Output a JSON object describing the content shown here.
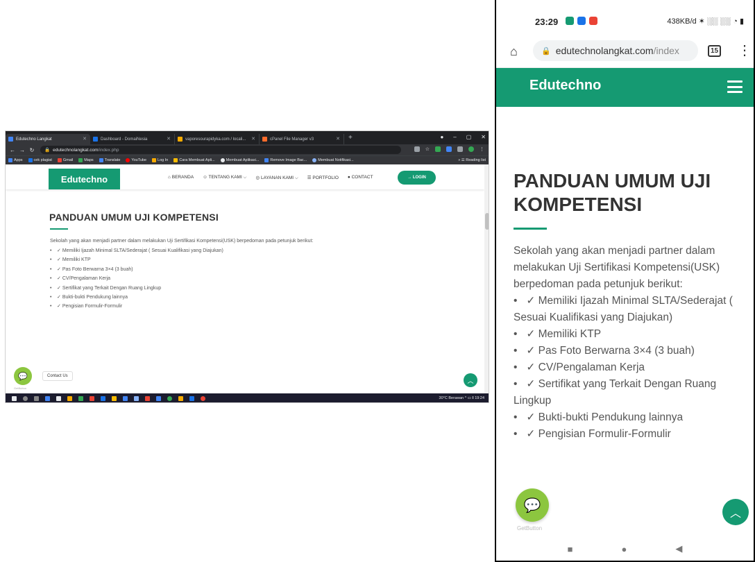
{
  "desktop": {
    "tabs": [
      {
        "title": "Edutechno Langkat",
        "color": "#4285f4",
        "active": true
      },
      {
        "title": "Dashboard - DomaiNesia",
        "color": "#1a73e8",
        "active": false
      },
      {
        "title": "vaporesourapidyka.com / locali...",
        "color": "#f9ab00",
        "active": false
      },
      {
        "title": "cPanel File Manager v3",
        "color": "#ff6c2c",
        "active": false
      }
    ],
    "url_host": "edutechnolangkat.com",
    "url_path": "/index.php",
    "bookmarks": [
      "Apps",
      "cek plagiat",
      "Gmail",
      "Maps",
      "Translate",
      "YouTube",
      "Log In",
      "Cara Membuat Apli...",
      "Membuat Aplikasi...",
      "Remove Image Bac...",
      "Membuat Notifikasi..."
    ],
    "reading_list": "Reading list",
    "brand": "Edutechno",
    "menu": [
      "⌂ BERANDA",
      "☺ TENTANG KAMI ⌵",
      "◎ LAYANAN KAMI ⌵",
      "☰ PORTFOLIO",
      "● CONTACT"
    ],
    "login": "→ LOGIN",
    "title": "PANDUAN UMUM UJI KOMPETENSI",
    "intro": "Sekolah yang akan menjadi partner dalam melakukan Uji Sertifikasi Kompetensi(USK) berpedoman pada petunjuk berikut:",
    "items": [
      "Memiliki Ijazah Minimal SLTA/Sederajat ( Sesuai Kualifikasi yang Diajukan)",
      "Memiliki KTP",
      "Pas Foto Berwarna 3×4 (3 buah)",
      "CV/Pengalaman Kerja",
      "Sertifikat yang Terkait Dengan Ruang Lingkup",
      "Bukti-bukti Pendukung lainnya",
      "Pengisian Formulir-Formulir"
    ],
    "contact_us": "Contact Us",
    "getbutton": "GetButton",
    "tray": "30°C Berawan  ^  ▭  ‖  19:24"
  },
  "phone": {
    "time": "23:29",
    "status_right": "438KB/d ✶ ░░ ░░ ◔ ▮",
    "url_host": "edutechnolangkat.com",
    "url_path": "/index",
    "tab_count": "15",
    "brand": "Edutechno",
    "title": "PANDUAN UMUM UJI KOMPETENSI",
    "intro": "Sekolah yang akan menjadi partner dalam melakukan Uji Sertifikasi Kompetensi(USK) berpedoman pada petunjuk berikut:",
    "items": [
      "Memiliki Ijazah Minimal SLTA/Sederajat ( Sesuai Kualifikasi yang Diajukan)",
      "Memiliki KTP",
      "Pas Foto Berwarna 3×4 (3 buah)",
      "CV/Pengalaman Kerja",
      "Sertifikat yang Terkait Dengan Ruang Lingkup",
      "Bukti-bukti Pendukung lainnya",
      "Pengisian Formulir-Formulir"
    ],
    "getbutton": "GetButton"
  },
  "colors": {
    "brand_green": "#159a72",
    "chat_green": "#8cc63f"
  }
}
